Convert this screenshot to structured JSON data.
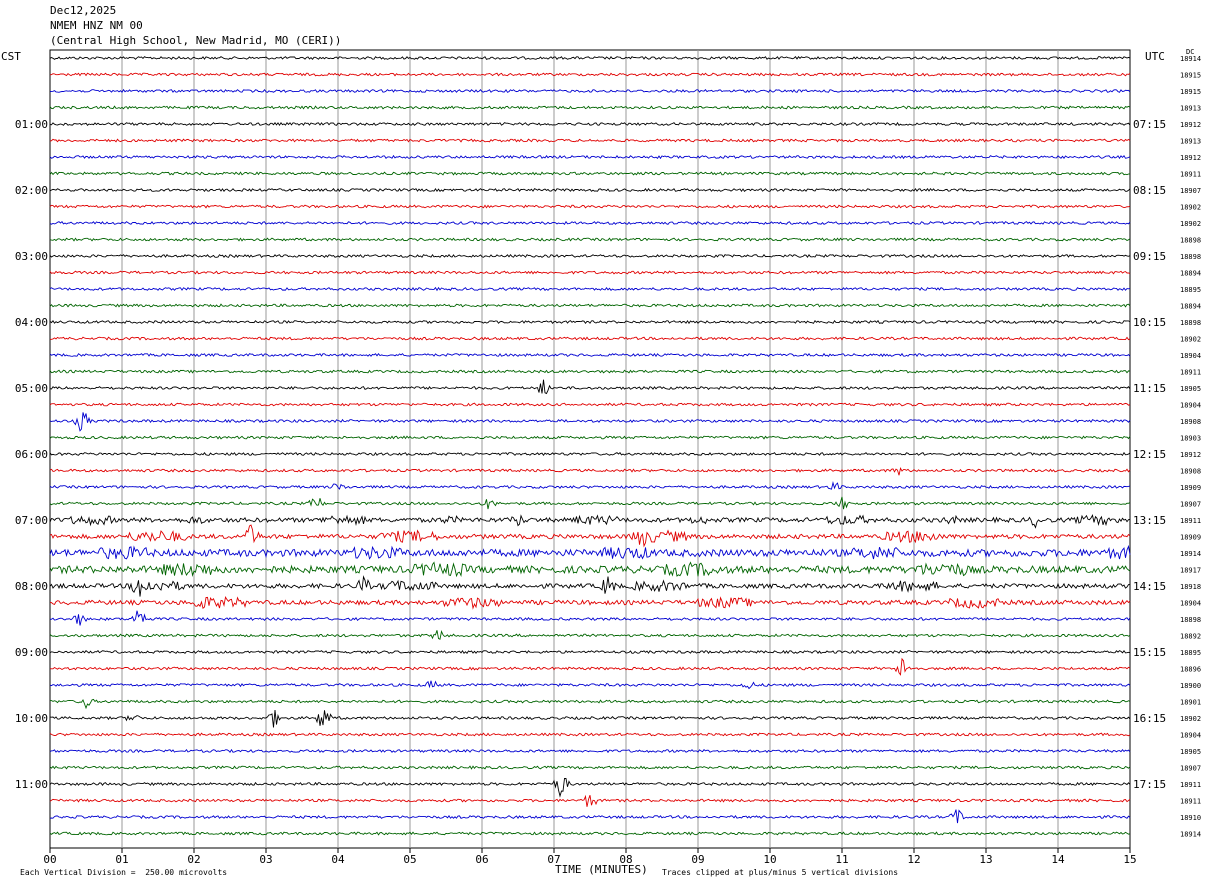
{
  "header": {
    "date": "Dec12,2025",
    "station": "NMEM HNZ NM 00",
    "location": "(Central High School, New Madrid, MO (CERI))"
  },
  "left_axis_label": "CST",
  "right_axis_label": "UTC",
  "dc_label": "DC",
  "footer": {
    "scale_note": "Each Vertical Division =  250.00 microvolts",
    "xlabel": "TIME (MINUTES)",
    "clip_note": "Traces clipped at plus/minus 5 vertical divisions"
  },
  "chart_data": {
    "type": "line",
    "title": "NMEM HNZ NM 00",
    "xlabel": "TIME (MINUTES)",
    "xlim": [
      0,
      15
    ],
    "x_ticks": [
      "00",
      "01",
      "02",
      "03",
      "04",
      "05",
      "06",
      "07",
      "08",
      "09",
      "10",
      "11",
      "12",
      "13",
      "14",
      "15"
    ],
    "grid": true,
    "trace_colors": [
      "#000000",
      "#e00000",
      "#0000d0",
      "#006400"
    ],
    "trace_count": 48,
    "left_time_labels": [
      "01:00",
      "02:00",
      "03:00",
      "04:00",
      "05:00",
      "06:00",
      "07:00",
      "08:00",
      "09:00",
      "10:00",
      "11:00"
    ],
    "right_time_labels": [
      "07:15",
      "08:15",
      "09:15",
      "10:15",
      "11:15",
      "12:15",
      "13:15",
      "14:15",
      "15:15",
      "16:15",
      "17:15"
    ],
    "dc_offsets": [
      "18914",
      "18915",
      "18915",
      "18913",
      "18912",
      "18913",
      "18912",
      "18911",
      "18907",
      "18902",
      "18902",
      "18898",
      "18898",
      "18894",
      "18895",
      "18894",
      "18898",
      "18902",
      "18904",
      "18911",
      "18905",
      "18904",
      "18908",
      "18903",
      "18912",
      "18908",
      "18909",
      "18907",
      "18911",
      "18909",
      "18914",
      "18917",
      "18918",
      "18904",
      "18898",
      "18892",
      "18895",
      "18896",
      "18900",
      "18901",
      "18902",
      "18904",
      "18905",
      "18907",
      "18911",
      "18911",
      "18910",
      "18914"
    ],
    "event_zone": {
      "traces": [
        28,
        33
      ],
      "note": "heavy activity"
    },
    "events": [
      {
        "trace": 20,
        "minute": 6.85,
        "amp": 8
      },
      {
        "trace": 22,
        "minute": 0.45,
        "amp": 12
      },
      {
        "trace": 25,
        "minute": 11.8,
        "amp": 4
      },
      {
        "trace": 26,
        "minute": 4.0,
        "amp": 4
      },
      {
        "trace": 26,
        "minute": 10.9,
        "amp": 4
      },
      {
        "trace": 27,
        "minute": 3.7,
        "amp": 8
      },
      {
        "trace": 27,
        "minute": 6.1,
        "amp": 5
      },
      {
        "trace": 27,
        "minute": 11.0,
        "amp": 6
      },
      {
        "trace": 28,
        "minute": 6.5,
        "amp": 5
      },
      {
        "trace": 28,
        "minute": 13.7,
        "amp": 6
      },
      {
        "trace": 29,
        "minute": 2.8,
        "amp": 12
      },
      {
        "trace": 29,
        "minute": 8.2,
        "amp": 8
      },
      {
        "trace": 32,
        "minute": 1.25,
        "amp": 10
      },
      {
        "trace": 32,
        "minute": 4.35,
        "amp": 8
      },
      {
        "trace": 32,
        "minute": 7.75,
        "amp": 10
      },
      {
        "trace": 33,
        "minute": 2.1,
        "amp": 4
      },
      {
        "trace": 34,
        "minute": 0.4,
        "amp": 6
      },
      {
        "trace": 34,
        "minute": 1.25,
        "amp": 14
      },
      {
        "trace": 35,
        "minute": 5.4,
        "amp": 6
      },
      {
        "trace": 37,
        "minute": 11.85,
        "amp": 12
      },
      {
        "trace": 38,
        "minute": 5.3,
        "amp": 4
      },
      {
        "trace": 38,
        "minute": 9.7,
        "amp": 4
      },
      {
        "trace": 39,
        "minute": 0.5,
        "amp": 6
      },
      {
        "trace": 40,
        "minute": 3.1,
        "amp": 9
      },
      {
        "trace": 40,
        "minute": 3.8,
        "amp": 14
      },
      {
        "trace": 40,
        "minute": 1.15,
        "amp": 4
      },
      {
        "trace": 44,
        "minute": 7.1,
        "amp": 14
      },
      {
        "trace": 45,
        "minute": 7.5,
        "amp": 8
      },
      {
        "trace": 46,
        "minute": 12.6,
        "amp": 8
      }
    ]
  }
}
